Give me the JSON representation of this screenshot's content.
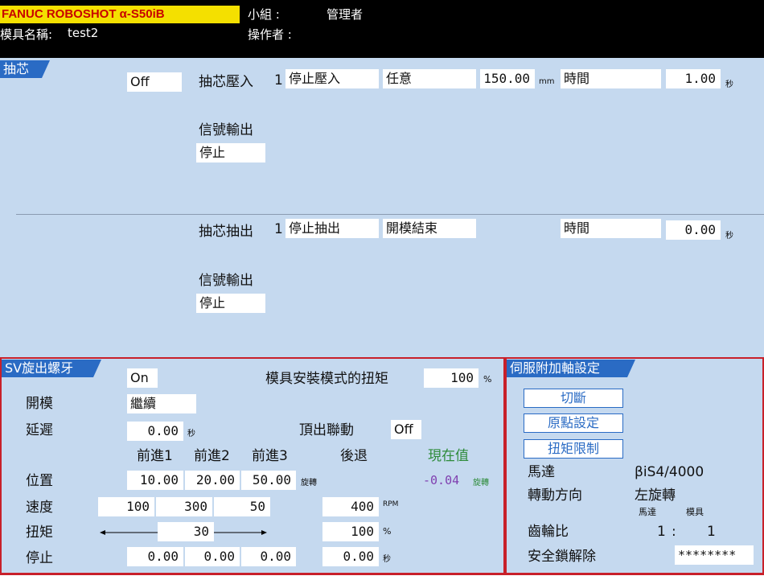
{
  "header": {
    "logo": "FANUC ROBOSHOT α-S50iB",
    "mold_label": "模具名稱:",
    "mold_value": "test2",
    "group_label": "小組 :",
    "group_value": "管理者",
    "operator_label": "操作者 :"
  },
  "core": {
    "tab": "抽芯",
    "mode": "Off",
    "in": {
      "label": "抽芯壓入",
      "index": "1",
      "stop": "停止壓入",
      "condition": "任意",
      "position": "150.00",
      "position_unit": "mm",
      "time_label": "時間",
      "time": "1.00",
      "time_unit": "秒",
      "signal_label": "信號輸出",
      "signal_value": "停止"
    },
    "out": {
      "label": "抽芯抽出",
      "index": "1",
      "stop": "停止抽出",
      "condition": "開模結束",
      "time_label": "時間",
      "time": "0.00",
      "time_unit": "秒",
      "signal_label": "信號輸出",
      "signal_value": "停止"
    }
  },
  "sv": {
    "tab": "SV旋出螺牙",
    "mode": "On",
    "torque_mode_label": "模具安裝模式的扭矩",
    "torque_mode_value": "100",
    "percent": "%",
    "open_label": "開模",
    "open_value": "繼續",
    "delay_label": "延遲",
    "delay_value": "0.00",
    "sec": "秒",
    "ejector_label": "頂出聯動",
    "ejector_value": "Off",
    "cols": {
      "f1": "前進1",
      "f2": "前進2",
      "f3": "前進3",
      "back": "後退",
      "current": "現在值"
    },
    "pos_label": "位置",
    "pos": [
      "10.00",
      "20.00",
      "50.00"
    ],
    "rot": "旋轉",
    "current_value": "-0.04",
    "speed_label": "速度",
    "speed": [
      "100",
      "300",
      "50"
    ],
    "speed_back": "400",
    "rpm": "RPM",
    "torque_label": "扭矩",
    "torque": "30",
    "torque_back": "100",
    "stop_label": "停止",
    "stop": [
      "0.00",
      "0.00",
      "0.00"
    ],
    "stop_back": "0.00"
  },
  "servo": {
    "tab": "伺服附加軸設定",
    "btn_off": "切斷",
    "btn_origin": "原點設定",
    "btn_torque": "扭矩限制",
    "motor_label": "馬達",
    "motor_value": "βiS4/4000",
    "dir_label": "轉動方向",
    "dir_value": "左旋轉",
    "motor_col": "馬達",
    "mold_col": "模具",
    "gear_label": "齒輪比",
    "gear_motor": "1",
    "gear_colon": ":",
    "gear_mold": "1",
    "safety_label": "安全鎖解除",
    "safety_value": "********"
  },
  "colors": {
    "accent": "#2a6bc4",
    "panel": "#c5d9ef",
    "alert": "#c8202a",
    "current": "#8040b0",
    "green": "#2e8b3a"
  }
}
